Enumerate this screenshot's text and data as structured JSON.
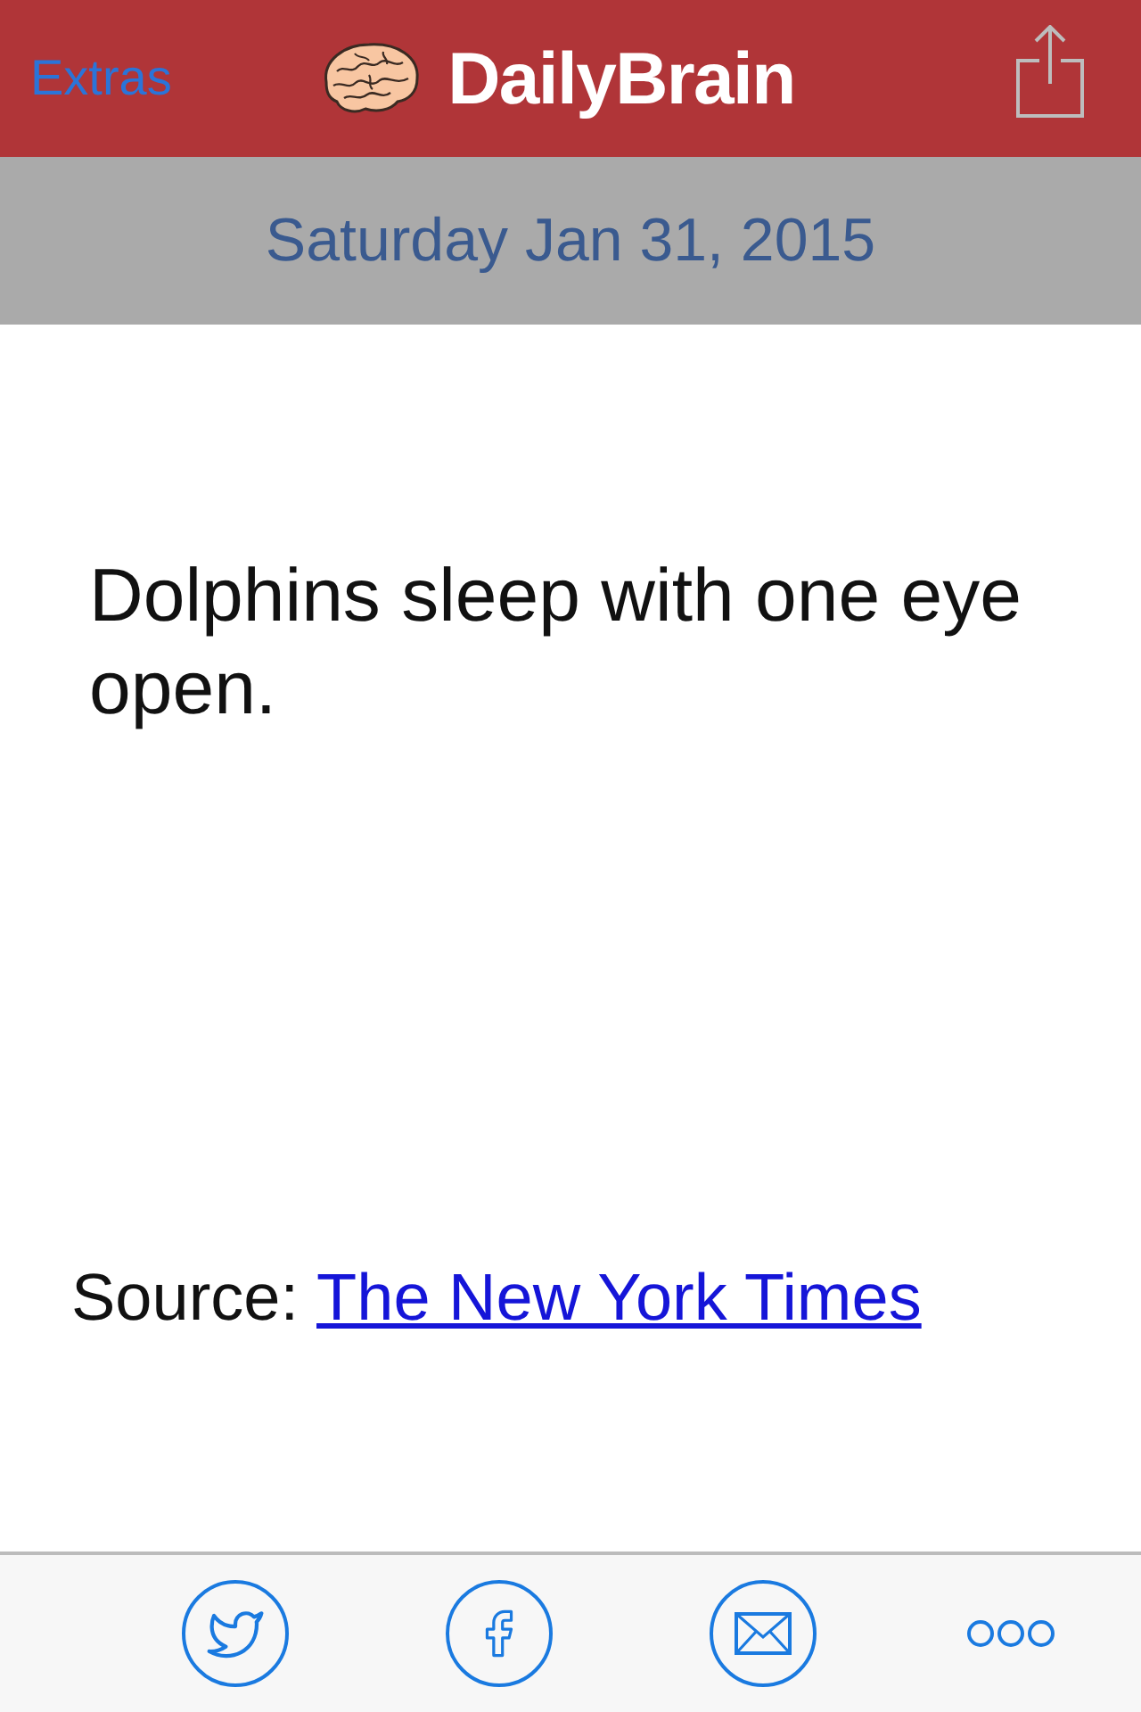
{
  "nav_bar": {
    "left_button": "Extras",
    "title": "DailyBrain"
  },
  "date_bar": {
    "date": "Saturday Jan 31, 2015"
  },
  "fact": {
    "text": "Dolphins sleep with one eye open."
  },
  "source": {
    "label": "Source:",
    "link": "The New York Times"
  },
  "share_bar": {
    "buttons": [
      {
        "kind": "twitter"
      },
      {
        "kind": "facebook"
      },
      {
        "kind": "email"
      },
      {
        "kind": "more"
      }
    ]
  }
}
